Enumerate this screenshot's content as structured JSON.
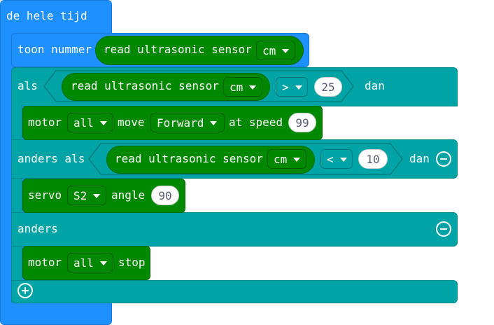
{
  "forever": {
    "label": "de hele tijd"
  },
  "show_number": {
    "label": "toon nummer",
    "sensor": {
      "label": "read ultrasonic sensor",
      "unit": "cm"
    }
  },
  "if_block": {
    "if_label": "als",
    "then_label": "dan",
    "else_if_label": "anders als",
    "else_label": "anders",
    "cond1": {
      "sensor_label": "read ultrasonic sensor",
      "unit": "cm",
      "op": ">",
      "value": "25"
    },
    "cond2": {
      "sensor_label": "read ultrasonic sensor",
      "unit": "cm",
      "op": "<",
      "value": "10"
    }
  },
  "motor_move": {
    "label": "motor",
    "motor": "all",
    "move_label": "move",
    "direction": "Forward",
    "speed_label": "at speed",
    "speed": "99"
  },
  "servo": {
    "label": "servo",
    "servo": "S2",
    "angle_label": "angle",
    "angle": "90"
  },
  "motor_stop": {
    "label": "motor",
    "motor": "all",
    "stop_label": "stop"
  },
  "colors": {
    "basic": "#1e90ff",
    "logic": "#00a4a6",
    "extension": "#008800"
  },
  "icons": {
    "remove": "minus-circle-icon",
    "add": "plus-circle-icon"
  }
}
